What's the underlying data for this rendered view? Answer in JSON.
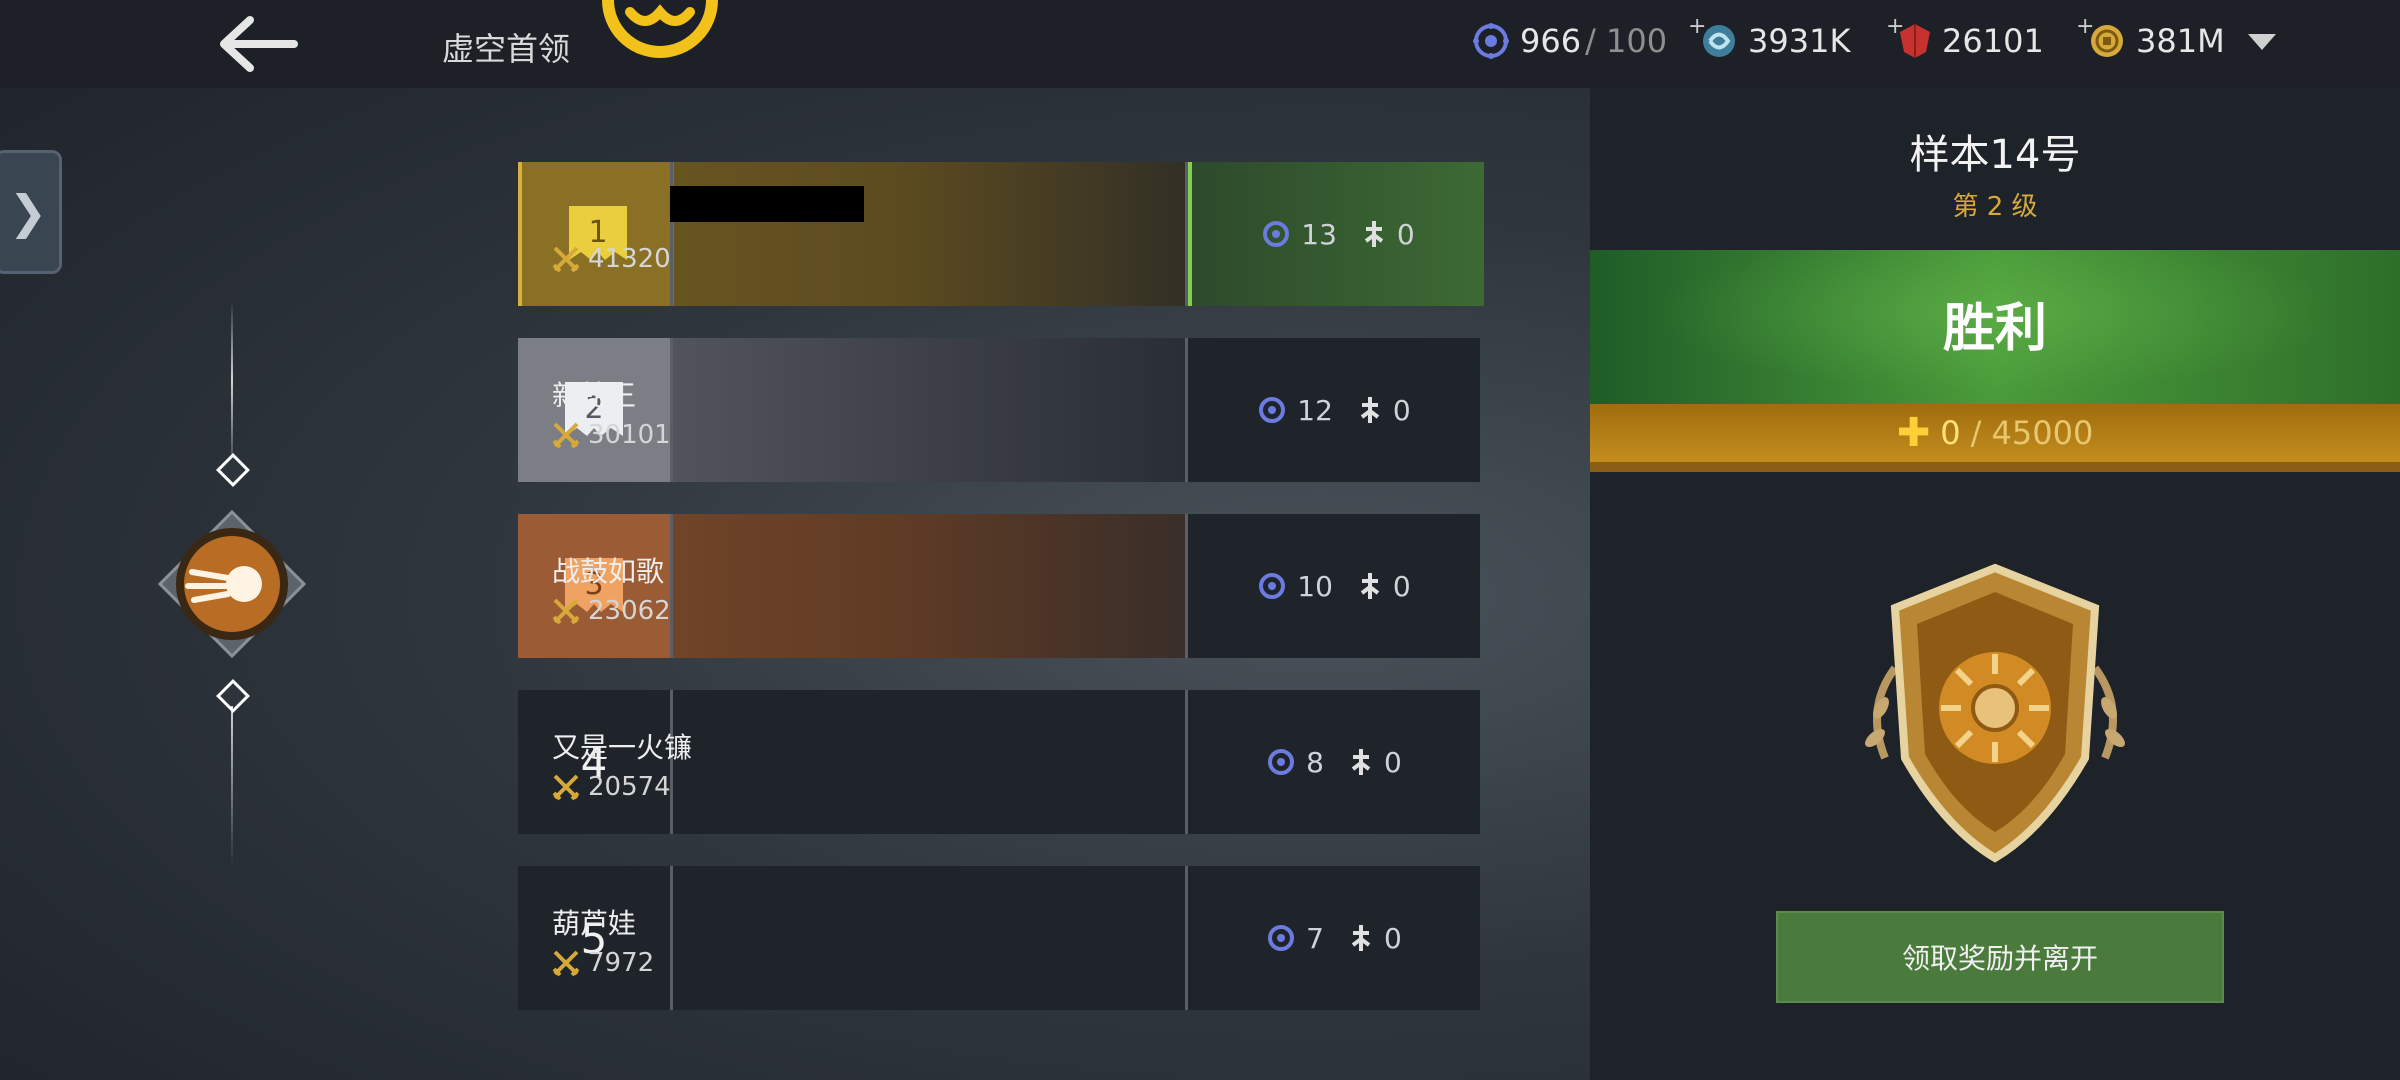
{
  "header": {
    "title": "虚空首领",
    "resources": [
      {
        "icon": "energy-gem-icon",
        "value": "966",
        "denominator": "/ 100",
        "has_plus": false
      },
      {
        "icon": "swirl-currency-icon",
        "value": "3931K",
        "has_plus": true
      },
      {
        "icon": "red-crystal-icon",
        "value": "26101",
        "has_plus": true
      },
      {
        "icon": "gold-coin-icon",
        "value": "381M",
        "has_plus": true
      }
    ]
  },
  "side": {
    "tab_glyph": "❯"
  },
  "rankings": [
    {
      "rank": "1",
      "name": "",
      "score": "41320",
      "kills": "13",
      "deaths": "0"
    },
    {
      "rank": "2",
      "name": "新蛇王",
      "score": "30101",
      "kills": "12",
      "deaths": "0"
    },
    {
      "rank": "3",
      "name": "战鼓如歌",
      "score": "23062",
      "kills": "10",
      "deaths": "0"
    },
    {
      "rank": "4",
      "name": "又是一火镰",
      "score": "20574",
      "kills": "8",
      "deaths": "0"
    },
    {
      "rank": "5",
      "name": "葫芦娃",
      "score": "7972",
      "kills": "7",
      "deaths": "0"
    }
  ],
  "result": {
    "title": "样本14号",
    "level": "第 2 级",
    "outcome": "胜利",
    "progress_current": "0",
    "progress_max": "/ 45000",
    "progress_fraction": 0,
    "claim_button": "领取奖励并离开"
  },
  "colors": {
    "accent_gold": "#d7a93a",
    "victory_green": "#4a9c3a",
    "claim_green": "#4a7b3c"
  }
}
